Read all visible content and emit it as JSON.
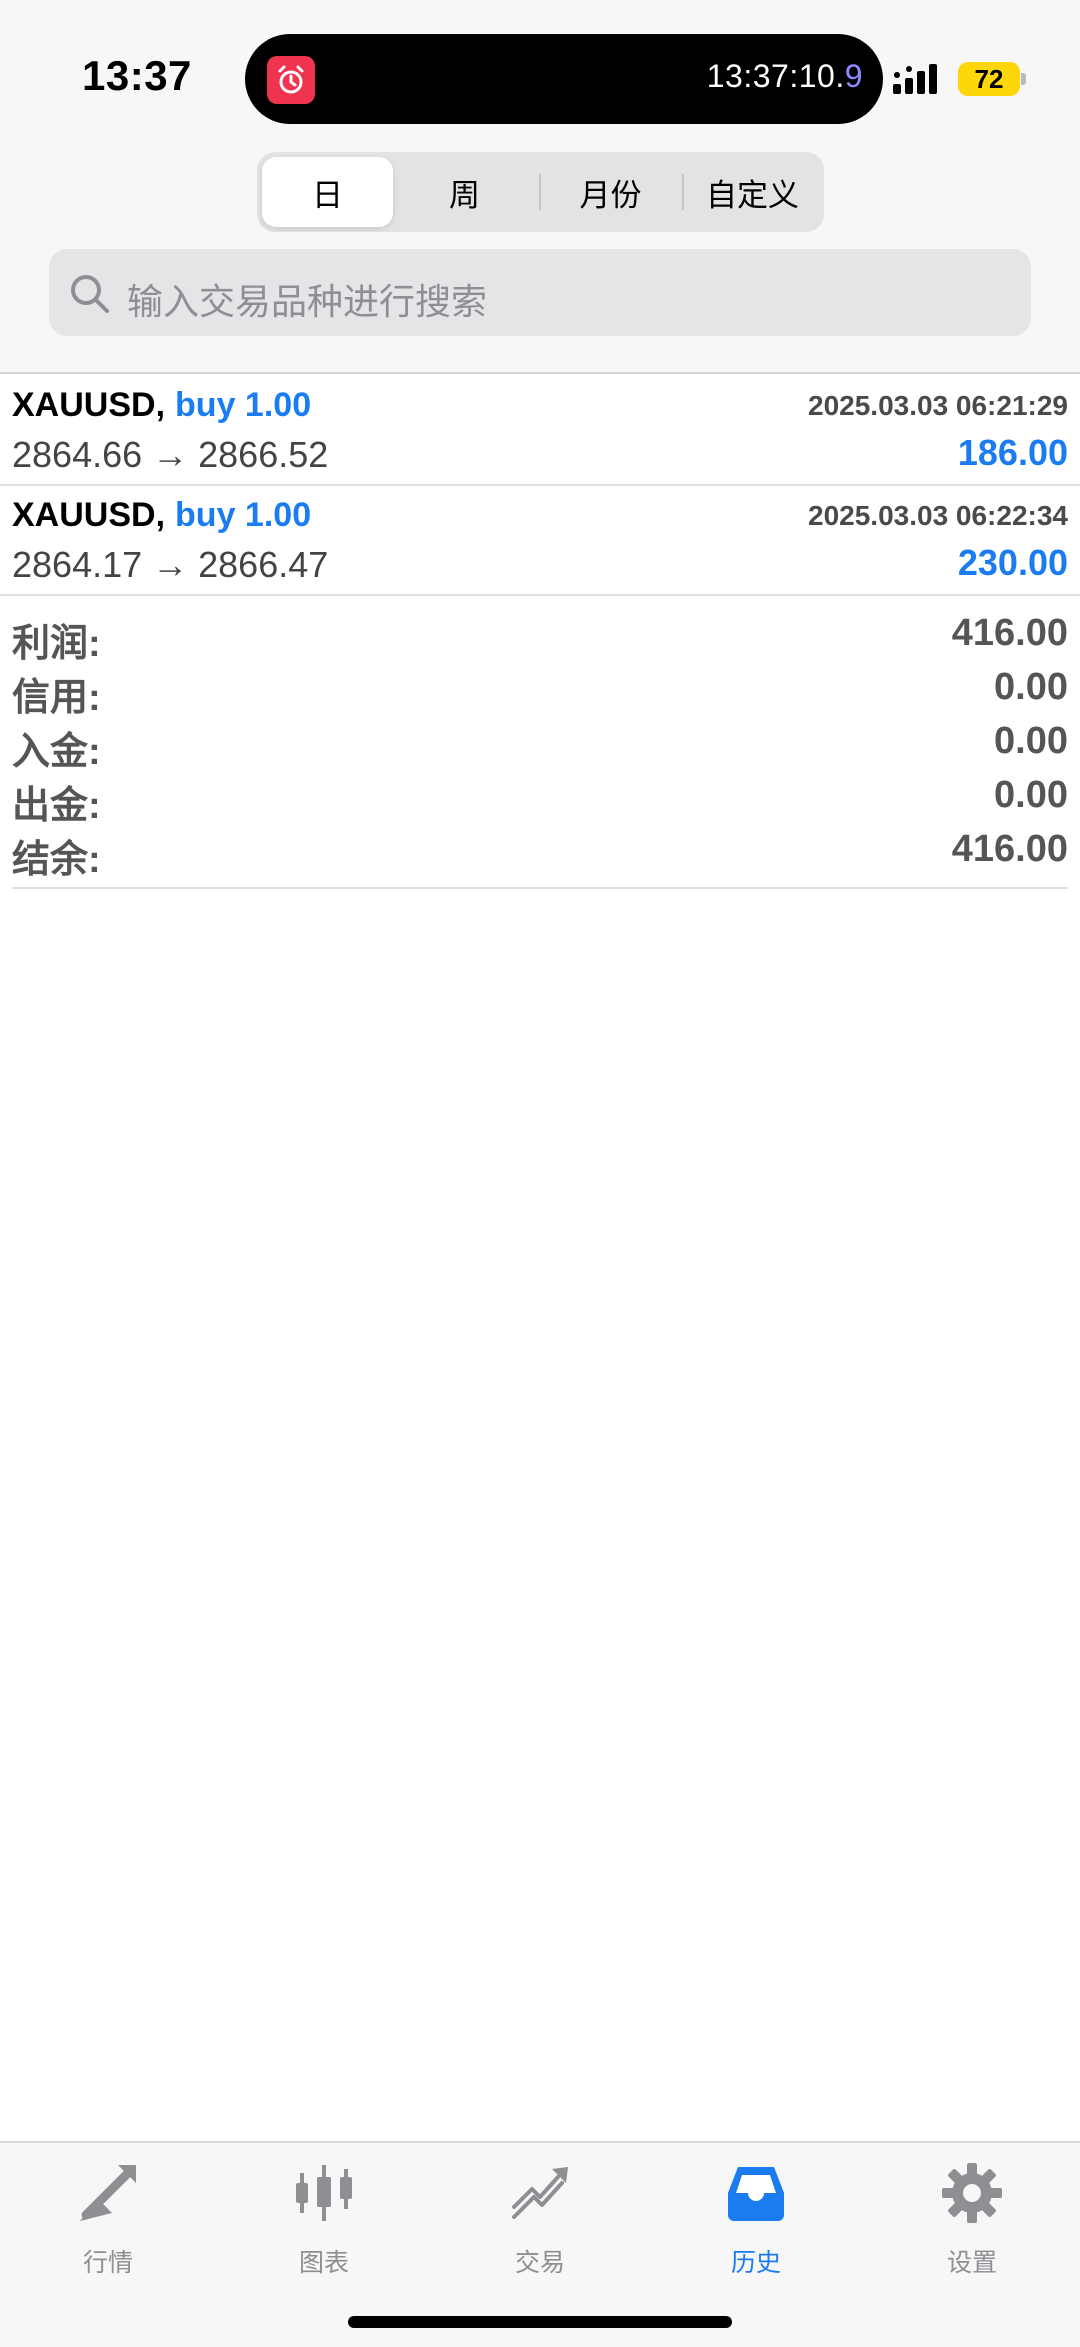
{
  "status_bar": {
    "time": "13:37",
    "island_timer_main": "13:37:10.",
    "island_timer_last": "9",
    "battery": "72",
    "alarm_icon": "alarm-clock-icon",
    "accent_alarm": "#f0334f",
    "battery_color": "#ffd60a"
  },
  "period_tabs": [
    {
      "label": "日",
      "active": true
    },
    {
      "label": "周",
      "active": false
    },
    {
      "label": "月份",
      "active": false
    },
    {
      "label": "自定义",
      "active": false
    }
  ],
  "search": {
    "placeholder": "输入交易品种进行搜索",
    "icon": "search-icon"
  },
  "trades": [
    {
      "symbol": "XAUUSD,",
      "action": "buy 1.00",
      "time": "2025.03.03 06:21:29",
      "prices": "2864.66 → 2866.52",
      "profit": "186.00"
    },
    {
      "symbol": "XAUUSD,",
      "action": "buy 1.00",
      "time": "2025.03.03 06:22:34",
      "prices": "2864.17 → 2866.47",
      "profit": "230.00"
    }
  ],
  "summary": [
    {
      "label": "利润:",
      "value": "416.00"
    },
    {
      "label": "信用:",
      "value": "0.00"
    },
    {
      "label": "入金:",
      "value": "0.00"
    },
    {
      "label": "出金:",
      "value": "0.00"
    },
    {
      "label": "结余:",
      "value": "416.00"
    }
  ],
  "tabbar": [
    {
      "label": "行情",
      "icon": "quotes-arrows-icon",
      "active": false
    },
    {
      "label": "图表",
      "icon": "candlestick-chart-icon",
      "active": false
    },
    {
      "label": "交易",
      "icon": "trade-trend-icon",
      "active": false
    },
    {
      "label": "历史",
      "icon": "history-inbox-icon",
      "active": true
    },
    {
      "label": "设置",
      "icon": "gear-icon",
      "active": false
    }
  ],
  "colors": {
    "accent": "#1a7cf0",
    "inactive_tab": "#8e8e93"
  }
}
